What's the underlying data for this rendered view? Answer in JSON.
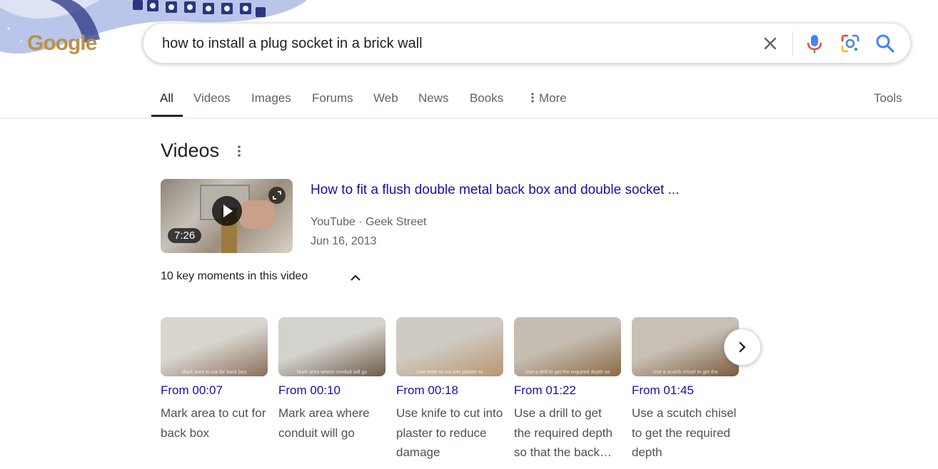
{
  "header": {
    "logo_text": "Google",
    "search": {
      "query": "how to install a plug socket in a brick wall",
      "icons": {
        "clear": "close-icon",
        "mic": "mic-icon",
        "lens": "lens-icon",
        "search": "search-icon"
      }
    }
  },
  "tabs": {
    "items": [
      {
        "label": "All",
        "active": true
      },
      {
        "label": "Videos"
      },
      {
        "label": "Images"
      },
      {
        "label": "Forums"
      },
      {
        "label": "Web"
      },
      {
        "label": "News"
      },
      {
        "label": "Books"
      },
      {
        "label": "More",
        "icon": "more-vert-icon"
      }
    ],
    "tools_label": "Tools"
  },
  "videos": {
    "section_title": "Videos",
    "result": {
      "title": "How to fit a flush double metal back box and double socket ...",
      "source": "YouTube · Geek Street",
      "date": "Jun 16, 2013",
      "duration": "7:26"
    },
    "key_moments": {
      "title": "10 key moments in this video",
      "items": [
        {
          "time": "From 00:07",
          "desc": "Mark area to cut for back box",
          "caption": "Mark area to cut for back box",
          "colors": [
            "#d9d6d0",
            "#8a6f5a"
          ]
        },
        {
          "time": "From 00:10",
          "desc": "Mark area where conduit will go",
          "caption": "Mark area where conduit will go",
          "colors": [
            "#d4d2cd",
            "#6d5a47"
          ]
        },
        {
          "time": "From 00:18",
          "desc": "Use knife to cut into plaster to reduce damage",
          "caption": "Use knife to cut into plaster to",
          "colors": [
            "#cfcac2",
            "#b8956f"
          ]
        },
        {
          "time": "From 01:22",
          "desc": "Use a drill to get the required depth so that the back…",
          "caption": "Use a drill to get the required depth so",
          "colors": [
            "#c5bdb2",
            "#8a6a44"
          ]
        },
        {
          "time": "From 01:45",
          "desc": "Use a scutch chisel to get the required depth",
          "caption": "Use a scutch chisel to get the",
          "colors": [
            "#c8c0b5",
            "#7a5a3c"
          ]
        }
      ]
    },
    "next_icon": "chevron-right-icon"
  },
  "colors": {
    "link": "#1a0dab",
    "text": "#202124",
    "muted": "#5f6368"
  }
}
